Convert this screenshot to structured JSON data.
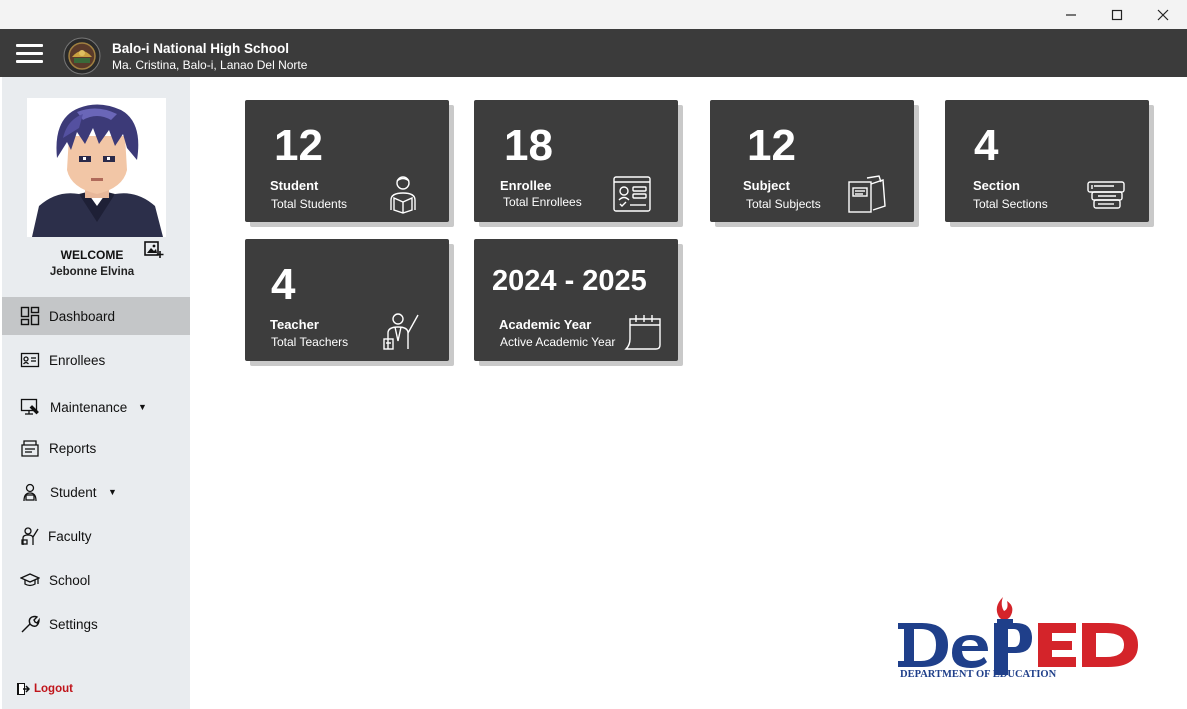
{
  "window": {
    "minimize_icon": "minimize-icon",
    "maximize_icon": "maximize-icon",
    "close_icon": "close-icon"
  },
  "header": {
    "school_name": "Balo-i National High School",
    "school_address": "Ma. Cristina, Balo-i, Lanao Del Norte"
  },
  "profile": {
    "welcome": "WELCOME",
    "username": "Jebonne Elvina"
  },
  "sidebar": {
    "items": [
      {
        "label": "Dashboard",
        "icon": "dashboard-icon",
        "active": true
      },
      {
        "label": "Enrollees",
        "icon": "enrollees-icon"
      },
      {
        "label": "Maintenance",
        "icon": "maintenance-icon",
        "dropdown": true
      },
      {
        "label": "Reports",
        "icon": "reports-icon"
      },
      {
        "label": "Student",
        "icon": "student-icon",
        "dropdown": true
      },
      {
        "label": "Faculty",
        "icon": "faculty-icon"
      },
      {
        "label": "School",
        "icon": "school-icon"
      },
      {
        "label": "Settings",
        "icon": "settings-icon"
      }
    ],
    "logout": "Logout"
  },
  "cards": [
    {
      "value": "12",
      "title": "Student",
      "subtitle": "Total Students",
      "icon": "student-reading-icon"
    },
    {
      "value": "18",
      "title": "Enrollee",
      "subtitle": "Total Enrollees",
      "icon": "enrollee-form-icon"
    },
    {
      "value": "12",
      "title": "Subject",
      "subtitle": "Total Subjects",
      "icon": "notebook-icon"
    },
    {
      "value": "4",
      "title": "Section",
      "subtitle": "Total Sections",
      "icon": "section-cards-icon"
    },
    {
      "value": "4",
      "title": "Teacher",
      "subtitle": "Total Teachers",
      "icon": "teacher-icon"
    },
    {
      "value": "2024 - 2025",
      "title": "Academic Year",
      "subtitle": "Active Academic Year",
      "icon": "calendar-icon"
    }
  ],
  "footer_logo": {
    "brand": "DepED",
    "caption": "DEPARTMENT OF EDUCATION"
  },
  "colors": {
    "appbar": "#3b3b3b",
    "card": "#3d3d3d",
    "sidebar": "#e9ecef",
    "active_item": "#c4c6c8",
    "logout": "#c0141a",
    "deped_blue": "#1f3f8a",
    "deped_red": "#d4242a"
  }
}
